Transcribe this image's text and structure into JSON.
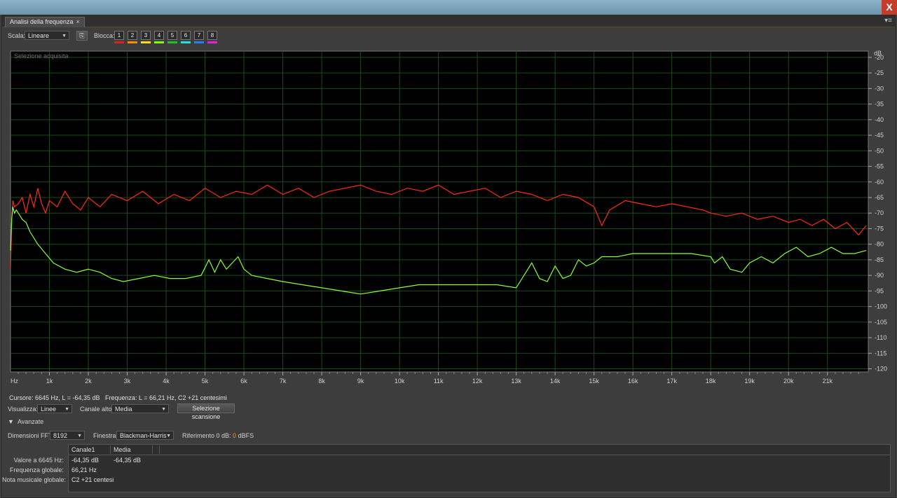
{
  "window": {
    "close_glyph": "X"
  },
  "tab": {
    "label": "Analisi della frequenza",
    "close": "×",
    "menu_icon": "panel-menu-icon"
  },
  "toolbar": {
    "scale_label": "Scala:",
    "scale_value": "Lineare",
    "block_label": "Blocca:",
    "blocks": [
      {
        "label": "1",
        "color": "#e02020"
      },
      {
        "label": "2",
        "color": "#ff8a00"
      },
      {
        "label": "3",
        "color": "#ffe000"
      },
      {
        "label": "4",
        "color": "#80ff00"
      },
      {
        "label": "5",
        "color": "#20c020"
      },
      {
        "label": "6",
        "color": "#20e0e0"
      },
      {
        "label": "7",
        "color": "#2080ff"
      },
      {
        "label": "8",
        "color": "#e020e0"
      }
    ]
  },
  "chart_data": {
    "type": "line",
    "caption": "Selezione acquisita",
    "yunit": "dB",
    "xlabel": "Hz",
    "xlim": [
      0,
      22050
    ],
    "ylim": [
      -121,
      -18
    ],
    "grid": true,
    "x_ticks": [
      "1k",
      "2k",
      "3k",
      "4k",
      "5k",
      "6k",
      "7k",
      "8k",
      "9k",
      "10k",
      "11k",
      "12k",
      "13k",
      "14k",
      "15k",
      "16k",
      "17k",
      "18k",
      "19k",
      "20k",
      "21k"
    ],
    "y_ticks": [
      -20,
      -25,
      -30,
      -35,
      -40,
      -45,
      -50,
      -55,
      -60,
      -65,
      -70,
      -75,
      -80,
      -85,
      -90,
      -95,
      -100,
      -105,
      -110,
      -115,
      -120
    ],
    "series": [
      {
        "color": "#ff2a1a",
        "x": [
          0,
          30,
          60,
          100,
          200,
          300,
          400,
          500,
          600,
          700,
          800,
          900,
          1000,
          1200,
          1400,
          1600,
          1800,
          2000,
          2300,
          2600,
          3000,
          3400,
          3800,
          4200,
          4600,
          5000,
          5400,
          5800,
          6200,
          6600,
          7000,
          7400,
          7800,
          8200,
          8600,
          9000,
          9400,
          9800,
          10200,
          10600,
          11000,
          11400,
          11800,
          12200,
          12600,
          13000,
          13400,
          13800,
          14200,
          14600,
          15000,
          15200,
          15400,
          15800,
          16200,
          16600,
          17000,
          17400,
          17800,
          18000,
          18400,
          18800,
          19200,
          19600,
          20000,
          20300,
          20600,
          20900,
          21200,
          21500,
          21800,
          22000
        ],
        "y": [
          -88,
          -72,
          -66,
          -68,
          -67,
          -65,
          -70,
          -64,
          -68,
          -62,
          -67,
          -70,
          -66,
          -68,
          -63,
          -67,
          -69,
          -65,
          -68,
          -64,
          -66,
          -63,
          -67,
          -64,
          -66,
          -62,
          -65,
          -63,
          -64,
          -61,
          -64,
          -62,
          -65,
          -63,
          -62,
          -61,
          -63,
          -64,
          -62,
          -63,
          -61,
          -64,
          -63,
          -62,
          -65,
          -63,
          -64,
          -66,
          -64,
          -65,
          -68,
          -74,
          -69,
          -66,
          -67,
          -68,
          -67,
          -68,
          -69,
          -70,
          -71,
          -70,
          -72,
          -71,
          -73,
          -72,
          -74,
          -72,
          -75,
          -73,
          -77,
          -74
        ]
      },
      {
        "color": "#8cff30",
        "x": [
          0,
          30,
          60,
          100,
          150,
          200,
          300,
          400,
          500,
          700,
          900,
          1100,
          1400,
          1700,
          2000,
          2300,
          2600,
          2900,
          3300,
          3700,
          4100,
          4500,
          4900,
          5100,
          5250,
          5400,
          5550,
          5700,
          5850,
          6000,
          6200,
          6600,
          7000,
          7500,
          8000,
          8500,
          9000,
          9500,
          10000,
          10500,
          11000,
          11500,
          12000,
          12500,
          13000,
          13200,
          13400,
          13600,
          13800,
          14000,
          14200,
          14400,
          14600,
          14800,
          15000,
          15200,
          15400,
          15600,
          16000,
          16500,
          17000,
          17500,
          18000,
          18100,
          18300,
          18500,
          18800,
          19000,
          19300,
          19600,
          19900,
          20200,
          20500,
          20800,
          21100,
          21400,
          21700,
          22000
        ],
        "y": [
          -82,
          -72,
          -68,
          -70,
          -69,
          -70,
          -72,
          -73,
          -76,
          -80,
          -83,
          -86,
          -88,
          -89,
          -88,
          -89,
          -91,
          -92,
          -91,
          -90,
          -91,
          -91,
          -90,
          -85,
          -89,
          -85,
          -88,
          -86,
          -84,
          -88,
          -90,
          -91,
          -92,
          -93,
          -94,
          -95,
          -96,
          -95,
          -94,
          -93,
          -93,
          -93,
          -93,
          -93,
          -94,
          -90,
          -86,
          -91,
          -92,
          -87,
          -91,
          -90,
          -85,
          -87,
          -86,
          -84,
          -84,
          -84,
          -83,
          -83,
          -83,
          -83,
          -84,
          -86,
          -84,
          -88,
          -89,
          -86,
          -84,
          -86,
          -83,
          -81,
          -84,
          -83,
          -81,
          -83,
          -83,
          -82
        ]
      }
    ]
  },
  "readout": {
    "cursor": "Cursore: 6645 Hz, L = -64,35 dB",
    "frequency": "Frequenza: L = 66,21 Hz, C2 +21 centesimi"
  },
  "controls": {
    "view_label": "Visualizza:",
    "view_value": "Linee",
    "channel_label": "Canale alto:",
    "channel_value": "Media",
    "scan_button": "Selezione scansione",
    "advanced_label": "Avanzate",
    "fft_label": "Dimensioni FFT:",
    "fft_value": "8192",
    "window_label": "Finestra:",
    "window_value": "Blackman-Harris",
    "reference_label": "Riferimento 0 dB:",
    "reference_value": "0",
    "reference_unit": "dBFS"
  },
  "table": {
    "headers": [
      "Canale1",
      "Media"
    ],
    "rows": [
      {
        "label": "Valore a 6645 Hz:",
        "values": [
          "-64,35 dB",
          "-64,35 dB"
        ]
      },
      {
        "label": "Frequenza globale:",
        "values": [
          "66,21 Hz",
          ""
        ]
      },
      {
        "label": "Nota musicale globale:",
        "values": [
          "C2 +21 centesi",
          ""
        ]
      }
    ]
  }
}
